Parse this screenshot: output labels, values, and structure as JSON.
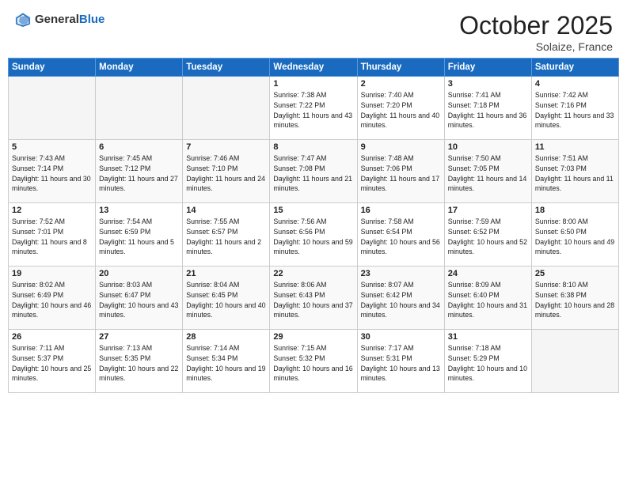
{
  "header": {
    "logo_general": "General",
    "logo_blue": "Blue",
    "month_title": "October 2025",
    "location": "Solaize, France"
  },
  "days_of_week": [
    "Sunday",
    "Monday",
    "Tuesday",
    "Wednesday",
    "Thursday",
    "Friday",
    "Saturday"
  ],
  "weeks": [
    [
      {
        "day": "",
        "empty": true
      },
      {
        "day": "",
        "empty": true
      },
      {
        "day": "",
        "empty": true
      },
      {
        "day": "1",
        "sunrise": "7:38 AM",
        "sunset": "7:22 PM",
        "daylight": "11 hours and 43 minutes."
      },
      {
        "day": "2",
        "sunrise": "7:40 AM",
        "sunset": "7:20 PM",
        "daylight": "11 hours and 40 minutes."
      },
      {
        "day": "3",
        "sunrise": "7:41 AM",
        "sunset": "7:18 PM",
        "daylight": "11 hours and 36 minutes."
      },
      {
        "day": "4",
        "sunrise": "7:42 AM",
        "sunset": "7:16 PM",
        "daylight": "11 hours and 33 minutes."
      }
    ],
    [
      {
        "day": "5",
        "sunrise": "7:43 AM",
        "sunset": "7:14 PM",
        "daylight": "11 hours and 30 minutes."
      },
      {
        "day": "6",
        "sunrise": "7:45 AM",
        "sunset": "7:12 PM",
        "daylight": "11 hours and 27 minutes."
      },
      {
        "day": "7",
        "sunrise": "7:46 AM",
        "sunset": "7:10 PM",
        "daylight": "11 hours and 24 minutes."
      },
      {
        "day": "8",
        "sunrise": "7:47 AM",
        "sunset": "7:08 PM",
        "daylight": "11 hours and 21 minutes."
      },
      {
        "day": "9",
        "sunrise": "7:48 AM",
        "sunset": "7:06 PM",
        "daylight": "11 hours and 17 minutes."
      },
      {
        "day": "10",
        "sunrise": "7:50 AM",
        "sunset": "7:05 PM",
        "daylight": "11 hours and 14 minutes."
      },
      {
        "day": "11",
        "sunrise": "7:51 AM",
        "sunset": "7:03 PM",
        "daylight": "11 hours and 11 minutes."
      }
    ],
    [
      {
        "day": "12",
        "sunrise": "7:52 AM",
        "sunset": "7:01 PM",
        "daylight": "11 hours and 8 minutes."
      },
      {
        "day": "13",
        "sunrise": "7:54 AM",
        "sunset": "6:59 PM",
        "daylight": "11 hours and 5 minutes."
      },
      {
        "day": "14",
        "sunrise": "7:55 AM",
        "sunset": "6:57 PM",
        "daylight": "11 hours and 2 minutes."
      },
      {
        "day": "15",
        "sunrise": "7:56 AM",
        "sunset": "6:56 PM",
        "daylight": "10 hours and 59 minutes."
      },
      {
        "day": "16",
        "sunrise": "7:58 AM",
        "sunset": "6:54 PM",
        "daylight": "10 hours and 56 minutes."
      },
      {
        "day": "17",
        "sunrise": "7:59 AM",
        "sunset": "6:52 PM",
        "daylight": "10 hours and 52 minutes."
      },
      {
        "day": "18",
        "sunrise": "8:00 AM",
        "sunset": "6:50 PM",
        "daylight": "10 hours and 49 minutes."
      }
    ],
    [
      {
        "day": "19",
        "sunrise": "8:02 AM",
        "sunset": "6:49 PM",
        "daylight": "10 hours and 46 minutes."
      },
      {
        "day": "20",
        "sunrise": "8:03 AM",
        "sunset": "6:47 PM",
        "daylight": "10 hours and 43 minutes."
      },
      {
        "day": "21",
        "sunrise": "8:04 AM",
        "sunset": "6:45 PM",
        "daylight": "10 hours and 40 minutes."
      },
      {
        "day": "22",
        "sunrise": "8:06 AM",
        "sunset": "6:43 PM",
        "daylight": "10 hours and 37 minutes."
      },
      {
        "day": "23",
        "sunrise": "8:07 AM",
        "sunset": "6:42 PM",
        "daylight": "10 hours and 34 minutes."
      },
      {
        "day": "24",
        "sunrise": "8:09 AM",
        "sunset": "6:40 PM",
        "daylight": "10 hours and 31 minutes."
      },
      {
        "day": "25",
        "sunrise": "8:10 AM",
        "sunset": "6:38 PM",
        "daylight": "10 hours and 28 minutes."
      }
    ],
    [
      {
        "day": "26",
        "sunrise": "7:11 AM",
        "sunset": "5:37 PM",
        "daylight": "10 hours and 25 minutes."
      },
      {
        "day": "27",
        "sunrise": "7:13 AM",
        "sunset": "5:35 PM",
        "daylight": "10 hours and 22 minutes."
      },
      {
        "day": "28",
        "sunrise": "7:14 AM",
        "sunset": "5:34 PM",
        "daylight": "10 hours and 19 minutes."
      },
      {
        "day": "29",
        "sunrise": "7:15 AM",
        "sunset": "5:32 PM",
        "daylight": "10 hours and 16 minutes."
      },
      {
        "day": "30",
        "sunrise": "7:17 AM",
        "sunset": "5:31 PM",
        "daylight": "10 hours and 13 minutes."
      },
      {
        "day": "31",
        "sunrise": "7:18 AM",
        "sunset": "5:29 PM",
        "daylight": "10 hours and 10 minutes."
      },
      {
        "day": "",
        "empty": true
      }
    ]
  ]
}
